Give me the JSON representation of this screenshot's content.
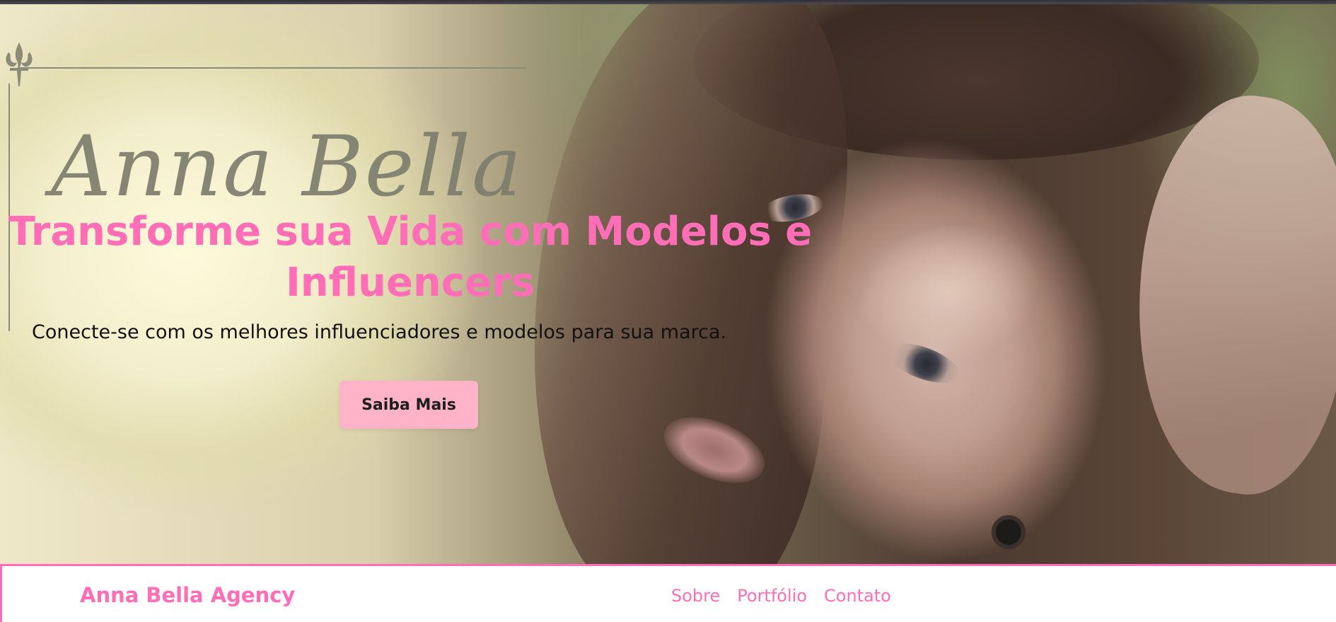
{
  "hero": {
    "logo_text": "Anna Bella",
    "title": "Transforme sua Vida com Modelos e Influencers",
    "subtitle": "Conecte-se com os melhores influenciadores e modelos para sua marca.",
    "cta_label": "Saiba Mais"
  },
  "navbar": {
    "brand": "Anna Bella Agency",
    "links": [
      {
        "label": "Sobre"
      },
      {
        "label": "Portfólio"
      },
      {
        "label": "Contato"
      }
    ]
  },
  "colors": {
    "accent_pink": "#ff6eb6",
    "button_pink": "#ffb3c9",
    "logo_gray": "#8b8b7a"
  },
  "icons": {
    "ornament": "fleur-de-lis-icon"
  }
}
